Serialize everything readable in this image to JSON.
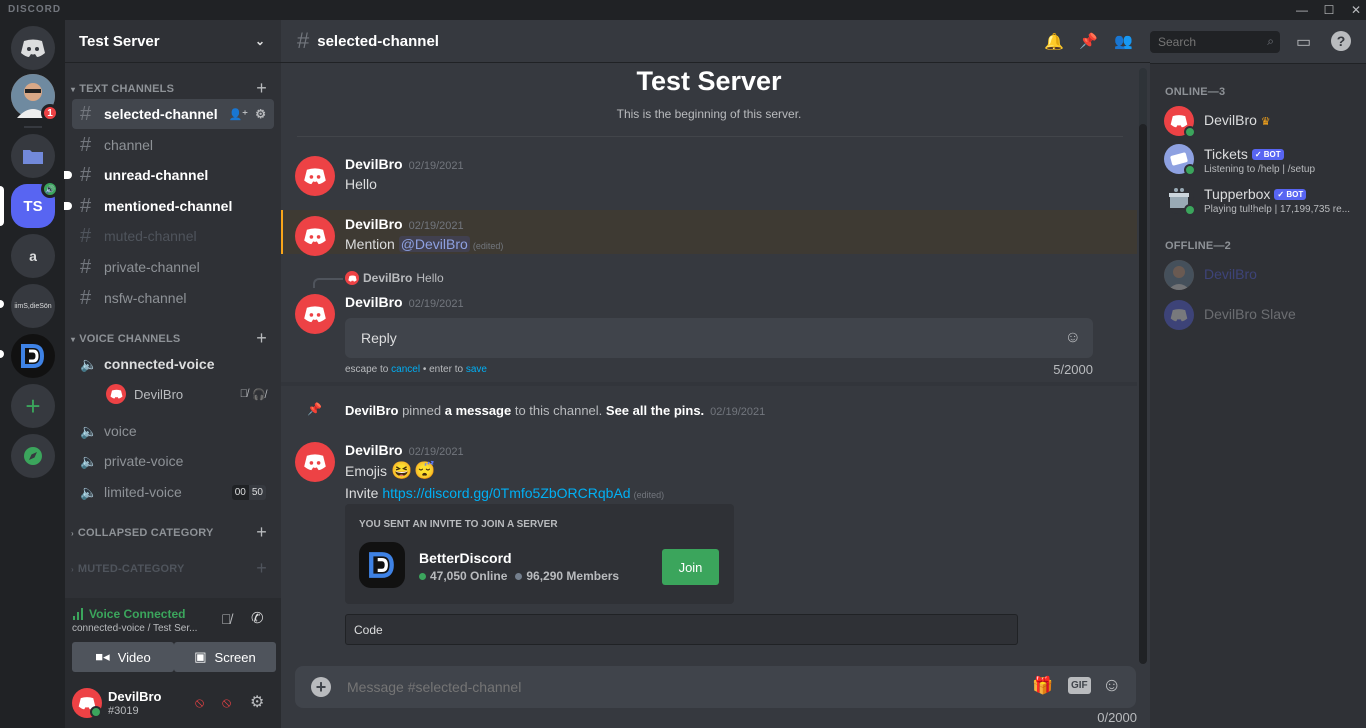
{
  "titlebar": {
    "logo": "DISCORD"
  },
  "guilds": {
    "badge_count": "1",
    "ts_label": "TS",
    "a_label": "a",
    "long_label": "iimS,dieSön"
  },
  "sidebar": {
    "server_name": "Test Server",
    "text_category": "TEXT CHANNELS",
    "text_channels": [
      "selected-channel",
      "channel",
      "unread-channel",
      "mentioned-channel",
      "muted-channel",
      "private-channel",
      "nsfw-channel"
    ],
    "voice_category": "VOICE CHANNELS",
    "voice_channels": [
      "connected-voice",
      "voice",
      "private-voice",
      "limited-voice"
    ],
    "voice_user": "DevilBro",
    "limit_left": "00",
    "limit_right": "50",
    "collapsed_category": "COLLAPSED CATEGORY",
    "muted_category": "MUTED-CATEGORY"
  },
  "voice_panel": {
    "status": "Voice Connected",
    "location": "connected-voice / Test Ser...",
    "video_label": "Video",
    "screen_label": "Screen"
  },
  "user_panel": {
    "username": "DevilBro",
    "tag": "#3019"
  },
  "header": {
    "channel": "selected-channel",
    "search_placeholder": "Search"
  },
  "welcome": {
    "title": "Test Server",
    "subtitle": "This is the beginning of this server."
  },
  "messages": {
    "m1": {
      "author": "DevilBro",
      "time": "02/19/2021",
      "text": "Hello"
    },
    "m2": {
      "author": "DevilBro",
      "time": "02/19/2021",
      "text_prefix": "Mention ",
      "mention": "@DevilBro",
      "edited": "(edited)"
    },
    "m3": {
      "reply_author": "DevilBro",
      "reply_text": "Hello",
      "author": "DevilBro",
      "time": "02/19/2021",
      "edit_value": "Reply",
      "hint_escape": "escape to ",
      "cancel": "cancel",
      "hint_enter": " • enter to ",
      "save": "save",
      "counter": "5/2000"
    },
    "pin": {
      "author": "DevilBro",
      "t1": " pinned ",
      "t2": "a message",
      "t3": " to this channel. ",
      "t4": "See all the pins.",
      "time": "02/19/2021"
    },
    "m4": {
      "author": "DevilBro",
      "time": "02/19/2021",
      "emojis_label": "Emojis",
      "invite_label": "Invite ",
      "link": "https://discord.gg/0Tmfo5ZbORCRqbAd",
      "edited": "(edited)"
    },
    "invite": {
      "heading": "YOU SENT AN INVITE TO JOIN A SERVER",
      "server": "BetterDiscord",
      "online": "47,050 Online",
      "members": "96,290 Members",
      "join": "Join"
    },
    "code": "Code"
  },
  "composer": {
    "placeholder": "Message #selected-channel",
    "counter": "0/2000",
    "gif": "GIF"
  },
  "members": {
    "online_header": "ONLINE—3",
    "offline_header": "OFFLINE—2",
    "online": [
      {
        "name": "DevilBro",
        "activity": ""
      },
      {
        "name": "Tickets",
        "activity": "Listening to /help | /setup",
        "bot": "BOT"
      },
      {
        "name": "Tupperbox",
        "activity": "Playing tul!help | 17,199,735 re...",
        "bot": "BOT"
      }
    ],
    "offline": [
      {
        "name": "DevilBro"
      },
      {
        "name": "DevilBro Slave"
      }
    ]
  },
  "colors": {
    "accent": "#5865f2",
    "online": "#3ba55c",
    "red": "#ed4245",
    "link": "#00b0f4"
  }
}
